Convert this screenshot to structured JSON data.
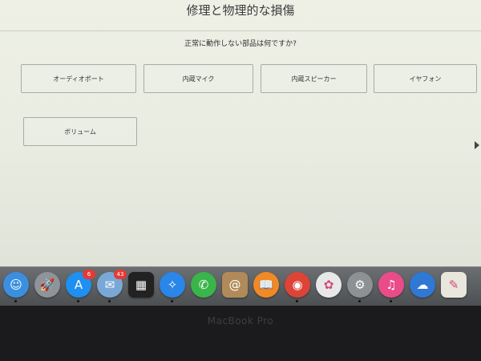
{
  "page": {
    "title": "修理と物理的な損傷",
    "question": "正常に動作しない部品は何ですか?"
  },
  "options": [
    {
      "label": "オーディオポート"
    },
    {
      "label": "内蔵マイク"
    },
    {
      "label": "内蔵スピーカー"
    },
    {
      "label": "イヤフォン"
    },
    {
      "label": "ボリューム"
    }
  ],
  "dock": {
    "apps": [
      {
        "name": "finder-icon",
        "glyph": "☺",
        "color": "#3b8fe0"
      },
      {
        "name": "launchpad-icon",
        "glyph": "🚀",
        "color": "#8e9499"
      },
      {
        "name": "app-store-icon",
        "glyph": "A",
        "color": "#1f8ff0",
        "badge": "6"
      },
      {
        "name": "mail-icon",
        "glyph": "✉",
        "color": "#7aa8d6",
        "badge": "43"
      },
      {
        "name": "photo-booth-icon",
        "glyph": "▦",
        "color": "#222222"
      },
      {
        "name": "safari-icon",
        "glyph": "✧",
        "color": "#2a86e8"
      },
      {
        "name": "facetime-icon",
        "glyph": "✆",
        "color": "#39b54a"
      },
      {
        "name": "contacts-icon",
        "glyph": "@",
        "color": "#b08a58"
      },
      {
        "name": "ibooks-icon",
        "glyph": "📖",
        "color": "#f08a24"
      },
      {
        "name": "chrome-icon",
        "glyph": "◉",
        "color": "#db4437"
      },
      {
        "name": "photos-icon",
        "glyph": "✿",
        "color": "#e8e8e8"
      },
      {
        "name": "system-preferences-icon",
        "glyph": "⚙",
        "color": "#8d9194"
      },
      {
        "name": "itunes-icon",
        "glyph": "♫",
        "color": "#ea4c89"
      },
      {
        "name": "onedrive-icon",
        "glyph": "☁",
        "color": "#2f78d4"
      },
      {
        "name": "textedit-icon",
        "glyph": "✎",
        "color": "#e9e6dc"
      }
    ]
  },
  "bezel": {
    "label": "MacBook Pro"
  },
  "colors": {
    "screen_bg": "#eef0e6",
    "option_border": "#a8aca2",
    "badge": "#e53935"
  }
}
